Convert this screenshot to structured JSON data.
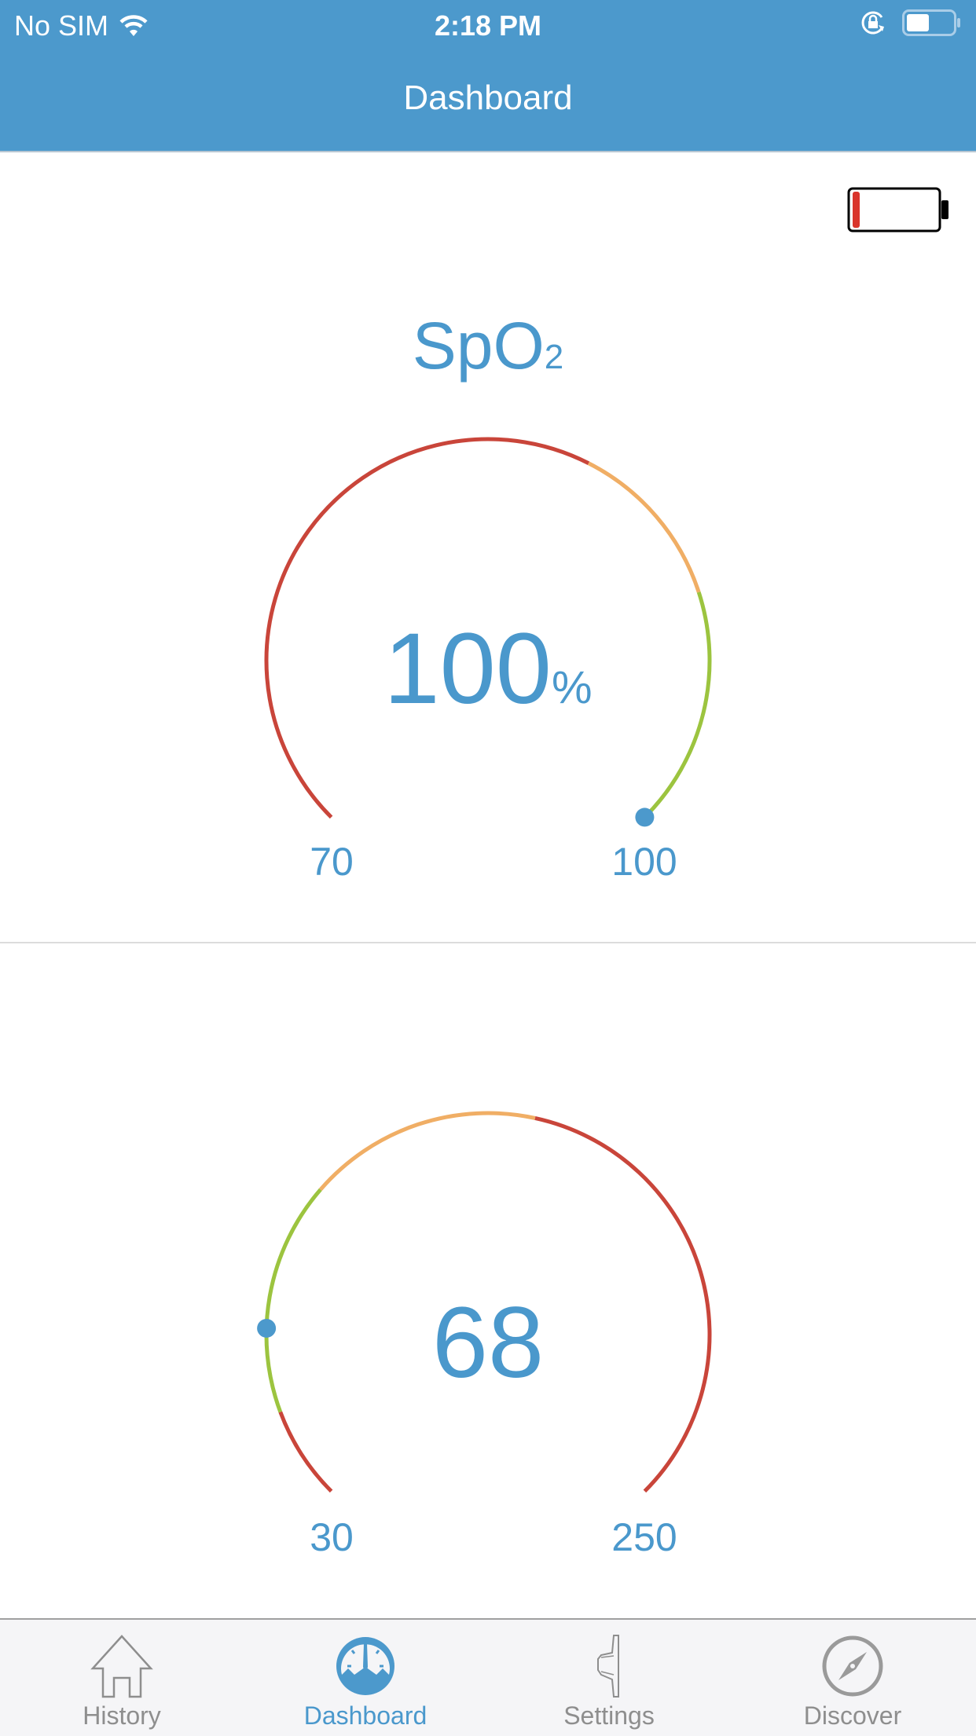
{
  "status_bar": {
    "carrier": "No SIM",
    "time": "2:18 PM",
    "icons": [
      "wifi-icon",
      "orientation-lock-icon",
      "battery-icon"
    ]
  },
  "nav": {
    "title": "Dashboard"
  },
  "device_battery": {
    "level_percent": 5,
    "color": "#d9342b"
  },
  "colors": {
    "accent": "#4c99cc",
    "red": "#c9453a",
    "orange": "#f0ae65",
    "green": "#9cc43f"
  },
  "gauges": [
    {
      "title": "SpO",
      "title_sub": "2",
      "value": "100",
      "unit": "%",
      "numeric_value": 100,
      "min": 70,
      "max": 100,
      "min_label": "70",
      "max_label": "100",
      "zones": [
        {
          "from": 70,
          "to": 88,
          "color": "#c9453a"
        },
        {
          "from": 88,
          "to": 93,
          "color": "#f0ae65"
        },
        {
          "from": 93,
          "to": 100,
          "color": "#9cc43f"
        }
      ]
    },
    {
      "title": "",
      "title_sub": "",
      "value": "68",
      "unit": "",
      "numeric_value": 68,
      "min": 30,
      "max": 250,
      "min_label": "30",
      "max_label": "250",
      "zones": [
        {
          "from": 30,
          "to": 50,
          "color": "#c9453a"
        },
        {
          "from": 50,
          "to": 100,
          "color": "#9cc43f"
        },
        {
          "from": 100,
          "to": 150,
          "color": "#f0ae65"
        },
        {
          "from": 150,
          "to": 250,
          "color": "#c9453a"
        }
      ]
    }
  ],
  "tabs": [
    {
      "label": "History",
      "icon": "house-icon",
      "active": false
    },
    {
      "label": "Dashboard",
      "icon": "speedometer-icon",
      "active": true
    },
    {
      "label": "Settings",
      "icon": "wrench-icon",
      "active": false
    },
    {
      "label": "Discover",
      "icon": "compass-icon",
      "active": false
    }
  ]
}
